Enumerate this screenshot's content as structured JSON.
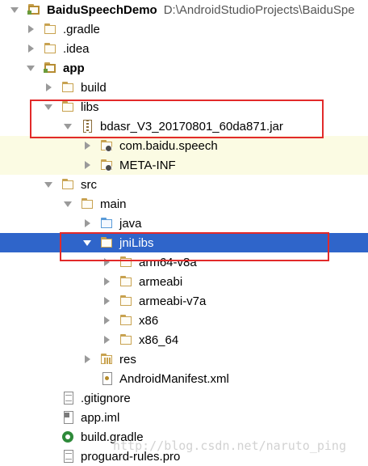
{
  "tree": {
    "root": {
      "name": "BaiduSpeechDemo",
      "path": "D:\\AndroidStudioProjects\\BaiduSpe"
    },
    "gradle": ".gradle",
    "idea": ".idea",
    "app": "app",
    "build": "build",
    "libs": "libs",
    "jar": "bdasr_V3_20170801_60da871.jar",
    "com_baidu_speech": "com.baidu.speech",
    "meta_inf": "META-INF",
    "src": "src",
    "main": "main",
    "java": "java",
    "jniLibs": "jniLibs",
    "arm64": "arm64-v8a",
    "armeabi": "armeabi",
    "armeabi_v7a": "armeabi-v7a",
    "x86": "x86",
    "x86_64": "x86_64",
    "res": "res",
    "manifest": "AndroidManifest.xml",
    "gitignore": ".gitignore",
    "app_iml": "app.iml",
    "build_gradle": "build.gradle",
    "proguard": "proguard-rules.pro"
  },
  "watermark": "http://blog.csdn.net/naruto_ping",
  "colors": {
    "selection": "#2f65ca",
    "highlight": "#fbfbe3",
    "annotation": "#e22a2a"
  }
}
